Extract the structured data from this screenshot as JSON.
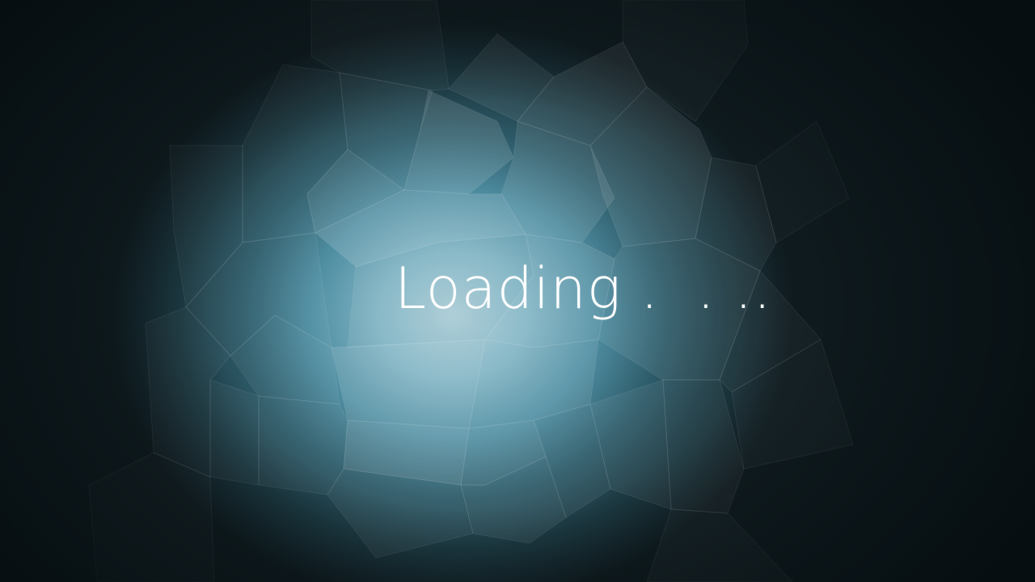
{
  "loading": {
    "text": "Loading .  . .."
  },
  "colors": {
    "background_dark": "#0f1a1e",
    "glow_center": "#a9cbd5",
    "glow_mid": "#4f8ea2",
    "text": "#ffffff"
  }
}
